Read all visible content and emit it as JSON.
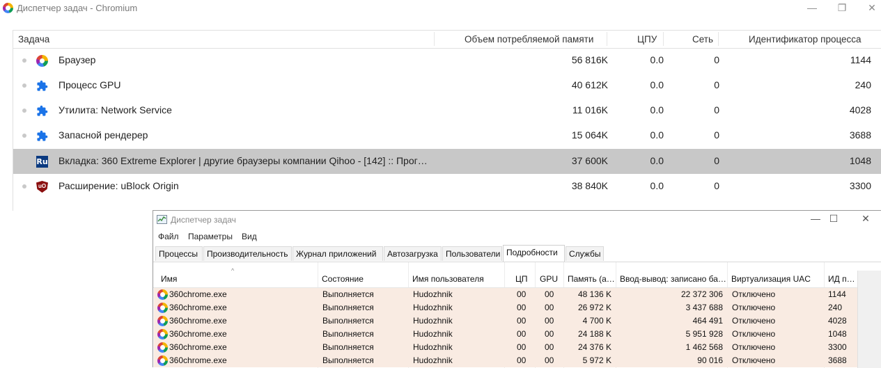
{
  "chromium": {
    "title": "Диспетчер задач - Chromium",
    "window_buttons": [
      "—",
      "❐",
      "✕"
    ],
    "columns": [
      "Задача",
      "Объем потребляемой памяти",
      "ЦПУ",
      "Сеть",
      "Идентификатор процесса"
    ],
    "rows": [
      {
        "icon": "browser-icon",
        "name": "Браузер",
        "memory": "56 816K",
        "cpu": "0.0",
        "net": "0",
        "pid": "1144"
      },
      {
        "icon": "puzzle-icon",
        "name": "Процесс GPU",
        "memory": "40 612K",
        "cpu": "0.0",
        "net": "0",
        "pid": "240"
      },
      {
        "icon": "puzzle-icon",
        "name": "Утилита: Network Service",
        "memory": "11 016K",
        "cpu": "0.0",
        "net": "0",
        "pid": "4028"
      },
      {
        "icon": "puzzle-icon",
        "name": "Запасной рендерер",
        "memory": "15 064K",
        "cpu": "0.0",
        "net": "0",
        "pid": "3688"
      },
      {
        "icon": "ru-icon",
        "icon_text": "Ru",
        "name": "Вкладка: 360 Extreme Explorer | другие браузеры компании Qihoo - [142] :: Прог…",
        "memory": "37 600K",
        "cpu": "0.0",
        "net": "0",
        "pid": "1048",
        "selected": true
      },
      {
        "icon": "ublock-icon",
        "icon_text": "uO",
        "name": "Расширение: uBlock Origin",
        "memory": "38 840K",
        "cpu": "0.0",
        "net": "0",
        "pid": "3300"
      }
    ]
  },
  "windows_tm": {
    "title": "Диспетчер задач",
    "window_buttons": [
      "—",
      "☐",
      "✕"
    ],
    "menu": [
      "Файл",
      "Параметры",
      "Вид"
    ],
    "tabs": [
      "Процессы",
      "Производительность",
      "Журнал приложений",
      "Автозагрузка",
      "Пользователи",
      "Подробности",
      "Службы"
    ],
    "active_tab": "Подробности",
    "sort_indicator": "^",
    "columns": [
      "Имя",
      "Состояние",
      "Имя пользователя",
      "ЦП",
      "GPU",
      "Память (а…",
      "Ввод-вывод: записано ба…",
      "Виртуализация UAC",
      "ИД п…"
    ],
    "rows": [
      {
        "name": "360chrome.exe",
        "state": "Выполняется",
        "user": "Hudozhnik",
        "cpu": "00",
        "gpu": "00",
        "memory": "48 136 K",
        "io": "22 372 306",
        "uac": "Отключено",
        "pid": "1144"
      },
      {
        "name": "360chrome.exe",
        "state": "Выполняется",
        "user": "Hudozhnik",
        "cpu": "00",
        "gpu": "00",
        "memory": "26 972 K",
        "io": "3 437 688",
        "uac": "Отключено",
        "pid": "240"
      },
      {
        "name": "360chrome.exe",
        "state": "Выполняется",
        "user": "Hudozhnik",
        "cpu": "00",
        "gpu": "00",
        "memory": "4 700 K",
        "io": "464 491",
        "uac": "Отключено",
        "pid": "4028"
      },
      {
        "name": "360chrome.exe",
        "state": "Выполняется",
        "user": "Hudozhnik",
        "cpu": "00",
        "gpu": "00",
        "memory": "24 188 K",
        "io": "5 951 928",
        "uac": "Отключено",
        "pid": "1048"
      },
      {
        "name": "360chrome.exe",
        "state": "Выполняется",
        "user": "Hudozhnik",
        "cpu": "00",
        "gpu": "00",
        "memory": "24 376 K",
        "io": "1 462 568",
        "uac": "Отключено",
        "pid": "3300"
      },
      {
        "name": "360chrome.exe",
        "state": "Выполняется",
        "user": "Hudozhnik",
        "cpu": "00",
        "gpu": "00",
        "memory": "5 972 K",
        "io": "90 016",
        "uac": "Отключено",
        "pid": "3688"
      }
    ]
  },
  "colors": {
    "selected_row": "#c8c8c8",
    "process_row": "#f9ebe2",
    "puzzle_icon": "#1a73e8"
  }
}
